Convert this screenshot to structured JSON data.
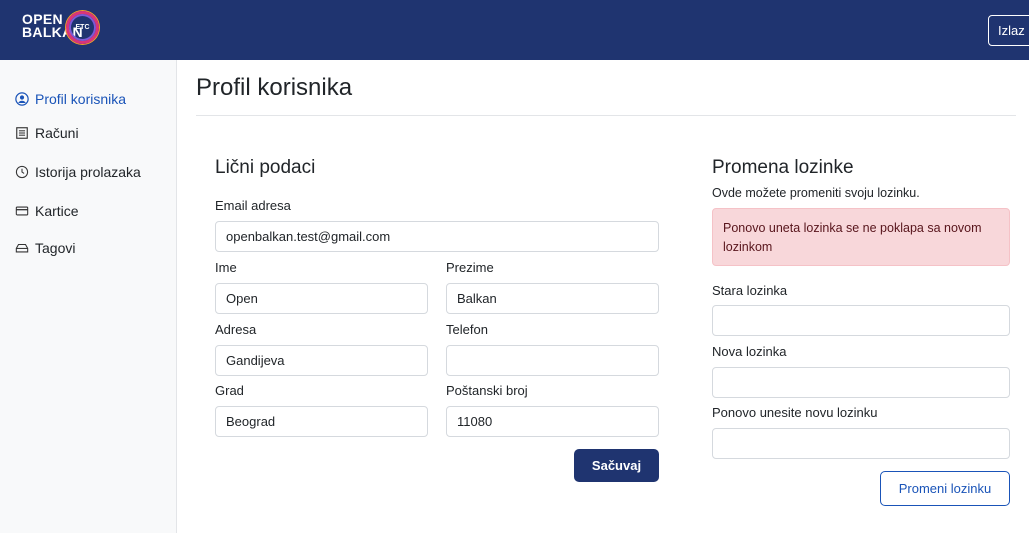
{
  "header": {
    "logo_line1": "OPEN",
    "logo_line2": "BALKAN",
    "logo_badge": "ETC",
    "logout_label": "Izlaz"
  },
  "sidebar": {
    "items": [
      {
        "label": "Profil korisnika",
        "icon": "user-circle-icon",
        "active": true
      },
      {
        "label": "Računi",
        "icon": "receipt-icon",
        "active": false
      },
      {
        "label": "Istorija prolazaka",
        "icon": "clock-icon",
        "active": false
      },
      {
        "label": "Kartice",
        "icon": "credit-card-icon",
        "active": false
      },
      {
        "label": "Tagovi",
        "icon": "tag-icon",
        "active": false
      }
    ]
  },
  "page": {
    "title": "Profil korisnika"
  },
  "personal": {
    "heading": "Lični podaci",
    "email_label": "Email adresa",
    "email_value": "openbalkan.test@gmail.com",
    "first_name_label": "Ime",
    "first_name_value": "Open",
    "last_name_label": "Prezime",
    "last_name_value": "Balkan",
    "address_label": "Adresa",
    "address_value": "Gandijeva",
    "phone_label": "Telefon",
    "phone_value": "",
    "city_label": "Grad",
    "city_value": "Beograd",
    "postal_label": "Poštanski broj",
    "postal_value": "11080",
    "save_label": "Sačuvaj"
  },
  "password": {
    "heading": "Promena lozinke",
    "description": "Ovde možete promeniti svoju lozinku.",
    "alert_text": "Ponovo uneta lozinka se ne poklapa sa novom lozinkom",
    "old_label": "Stara lozinka",
    "old_value": "",
    "new_label": "Nova lozinka",
    "new_value": "",
    "repeat_label": "Ponovo unesite novu lozinku",
    "repeat_value": "",
    "change_label": "Promeni lozinku"
  },
  "colors": {
    "brand": "#1f3470",
    "accent": "#1a54b8",
    "danger_bg": "#f8d7da"
  }
}
